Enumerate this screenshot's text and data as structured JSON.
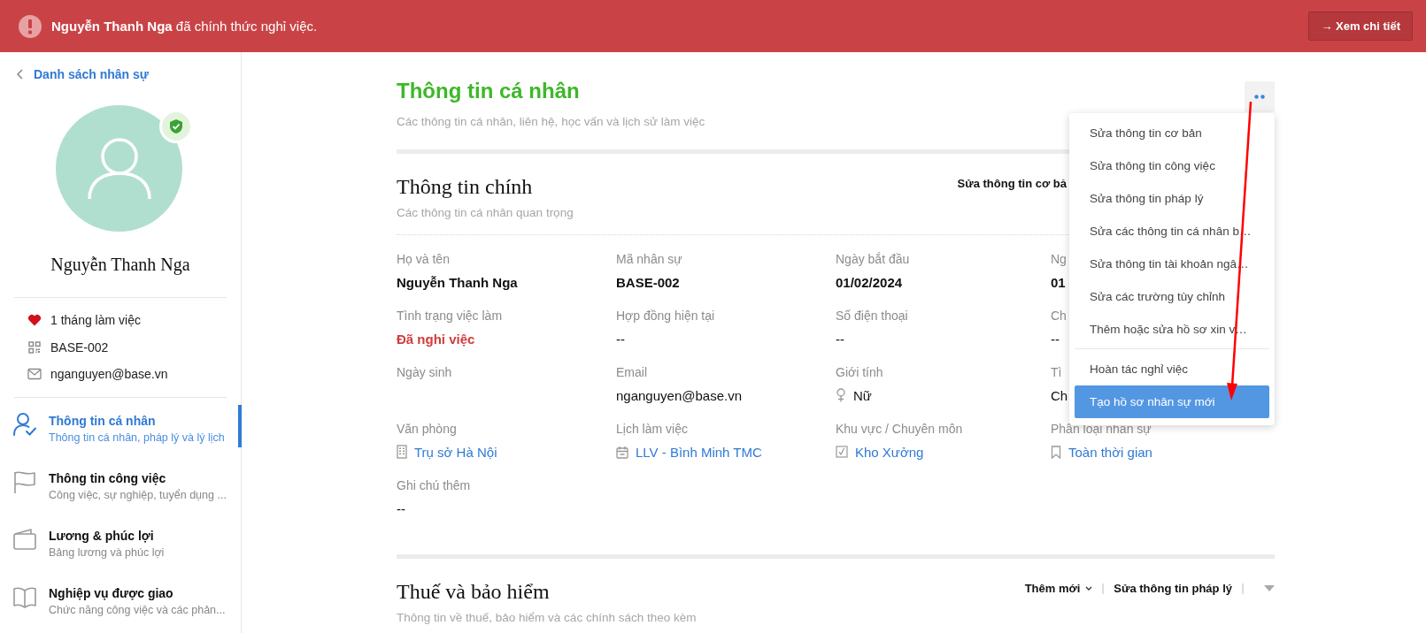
{
  "banner": {
    "message": "**Nguyễn Thanh Nga** đã chính thức nghỉ việc.",
    "button": "→ Xem chi tiết"
  },
  "sidebar": {
    "back_link": "Danh sách nhân sự",
    "verified": true,
    "name": "Nguyễn Thanh Nga",
    "facts": [
      {
        "kind": "tenure",
        "text": "1 tháng làm việc"
      },
      {
        "kind": "code",
        "text": "BASE-002"
      },
      {
        "kind": "email",
        "text": "nganguyen@base.vn"
      }
    ],
    "nav": [
      {
        "kind": "person",
        "title": "Thông tin cá nhân",
        "subtitle": "Thông tin cá nhân, pháp lý và lý lịch",
        "selected": true
      },
      {
        "kind": "flag",
        "title": "Thông tin công việc",
        "subtitle": "Công việc, sự nghiệp, tuyển dụng ...",
        "selected": false
      },
      {
        "kind": "wallet",
        "title": "Lương & phúc lợi",
        "subtitle": "Bảng lương và phúc lợi",
        "selected": false
      },
      {
        "kind": "book",
        "title": "Nghiệp vụ được giao",
        "subtitle": "Chức năng công việc và các phản...",
        "selected": false
      }
    ]
  },
  "page": {
    "title": "Thông tin cá nhân",
    "subtitle": "Các thông tin cá nhân, liên hệ, học vấn và lịch sử làm việc",
    "sections": [
      {
        "title": "Thông tin chính",
        "subtitle": "Các thông tin cá nhân quan trọng",
        "actions": [
          {
            "kind": "link",
            "label": "Sửa thông tin cơ bả"
          }
        ],
        "fields": [
          {
            "label": "Họ và tên",
            "value": "Nguyễn Thanh Nga",
            "kind": "bold"
          },
          {
            "label": "Mã nhân sự",
            "value": "BASE-002",
            "kind": "bold"
          },
          {
            "label": "Ngày bắt đầu",
            "value": "01/02/2024",
            "kind": "bold"
          },
          {
            "label": "Ng",
            "value": "01",
            "kind": "bold"
          },
          {
            "label": "Tình trạng việc làm",
            "value": "Đã nghỉ việc",
            "kind": "status"
          },
          {
            "label": "Hợp đồng hiện tại",
            "value": "--",
            "kind": "plain"
          },
          {
            "label": "Số điện thoại",
            "value": "--",
            "kind": "plain"
          },
          {
            "label": "Ch",
            "value": "--",
            "kind": "plain"
          },
          {
            "label": "Ngày sinh",
            "kind": "plain"
          },
          {
            "label": "Email",
            "value": "nganguyen@base.vn",
            "kind": "plain"
          },
          {
            "label": "Giới tính",
            "value": "Nữ",
            "kind": "gender"
          },
          {
            "label": "Tì",
            "value": "Ch",
            "kind": "plain"
          },
          {
            "label": "Văn phòng",
            "value": "Trụ sở Hà Nội",
            "kind": "office"
          },
          {
            "label": "Lịch làm việc",
            "value": "LLV - Bình Minh TMC",
            "kind": "schedule"
          },
          {
            "label": "Khu vực / Chuyên môn",
            "value": "Kho Xưởng",
            "kind": "area"
          },
          {
            "label": "Phân loại nhân sự",
            "value": "Toàn thời gian",
            "kind": "category"
          },
          {
            "label": "Ghi chú thêm",
            "value": "--",
            "kind": "plain"
          }
        ]
      },
      {
        "title": "Thuế và bảo hiểm",
        "subtitle": "Thông tin về thuế, bảo hiểm và các chính sách theo kèm",
        "actions": [
          {
            "kind": "dropdown",
            "label": "Thêm mới"
          },
          {
            "kind": "link",
            "label": "Sửa thông tin pháp lý"
          },
          {
            "kind": "caret"
          }
        ]
      }
    ]
  },
  "menu": {
    "groups": [
      {
        "items": [
          {
            "label": "Sửa thông tin cơ bản",
            "selected": false
          },
          {
            "label": "Sửa thông tin công việc",
            "selected": false
          },
          {
            "label": "Sửa thông tin pháp lý",
            "selected": false
          },
          {
            "label": "Sửa các thông tin cá nhân b…",
            "selected": false
          },
          {
            "label": "Sửa thông tin tài khoản ngâ…",
            "selected": false
          },
          {
            "label": "Sửa các trường tùy chỉnh",
            "selected": false
          },
          {
            "label": "Thêm hoặc sửa hồ sơ xin v…",
            "selected": false
          }
        ]
      },
      {
        "items": [
          {
            "label": "Hoàn tác nghỉ việc",
            "selected": false
          },
          {
            "label": "Tạo hồ sơ nhân sự mới",
            "selected": true
          }
        ]
      }
    ]
  }
}
